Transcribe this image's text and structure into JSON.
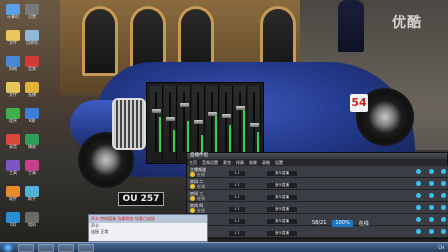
{
  "watermark": "优酷",
  "plate_text": "OU 257",
  "race_number": "54",
  "desktop_icons": [
    {
      "label": "计算机",
      "color": "#5aa0e6"
    },
    {
      "label": "文件",
      "color": "#e8c65a"
    },
    {
      "label": "网络",
      "color": "#4a86d6"
    },
    {
      "label": "文件",
      "color": "#e8c65a"
    },
    {
      "label": "程序",
      "color": "#3fb04a"
    },
    {
      "label": "录音",
      "color": "#d9493a"
    },
    {
      "label": "工具",
      "color": "#7b56c4"
    },
    {
      "label": "软件",
      "color": "#e68a2e"
    },
    {
      "label": "QQ",
      "color": "#2b8fd8"
    },
    {
      "label": "设置",
      "color": "#7a7a7a"
    },
    {
      "label": "回收站",
      "color": "#8fb8da"
    },
    {
      "label": "音频",
      "color": "#d33b3b"
    },
    {
      "label": "直播",
      "color": "#e0b53a"
    },
    {
      "label": "K歌",
      "color": "#3b7fd6"
    },
    {
      "label": "播放",
      "color": "#2f9e58"
    },
    {
      "label": "工具",
      "color": "#c73e8a"
    },
    {
      "label": "助手",
      "color": "#4fb0d8"
    },
    {
      "label": "相机",
      "color": "#6a6a6a"
    }
  ],
  "mixer": {
    "strips": [
      {
        "level": 0.62,
        "fader": 0.3
      },
      {
        "level": 0.4,
        "fader": 0.45
      },
      {
        "level": 0.55,
        "fader": 0.2
      },
      {
        "level": 0.3,
        "fader": 0.5
      },
      {
        "level": 0.7,
        "fader": 0.35
      },
      {
        "level": 0.48,
        "fader": 0.4
      },
      {
        "level": 0.8,
        "fader": 0.25
      },
      {
        "level": 0.35,
        "fader": 0.55
      }
    ]
  },
  "app": {
    "title": "直播伴侣",
    "toolbar": [
      "主页",
      "音频设置",
      "麦克",
      "伴奏",
      "效果",
      "录制",
      "设置"
    ],
    "rows": [
      {
        "name": "主播频道",
        "sub": "在线",
        "tag": "1 1",
        "tag2": "音乐直播"
      },
      {
        "name": "房间 二",
        "sub": "在线",
        "tag": "1 1",
        "tag2": "音乐直播"
      },
      {
        "name": "房间 三",
        "sub": "在线",
        "tag": "1 1",
        "tag2": "音乐直播"
      },
      {
        "name": "房间 四",
        "sub": "在线",
        "tag": "1 1",
        "tag2": "音乐直播"
      },
      {
        "name": "房间 五",
        "sub": "在线",
        "tag": "1 1",
        "tag2": "音乐直播"
      },
      {
        "name": "房间 六",
        "sub": "在线",
        "tag": "1 1",
        "tag2": "音乐直播"
      }
    ]
  },
  "status_popup": {
    "header": "声卡·控制面板  连接状态 设备已连接",
    "lines": [
      "声卡",
      "连接 正常"
    ]
  },
  "readout": {
    "a": "58/21",
    "b": "100%",
    "c": "在线"
  },
  "taskbar": {
    "tasks": [
      "",
      "",
      "",
      ""
    ],
    "tray": "CH"
  }
}
